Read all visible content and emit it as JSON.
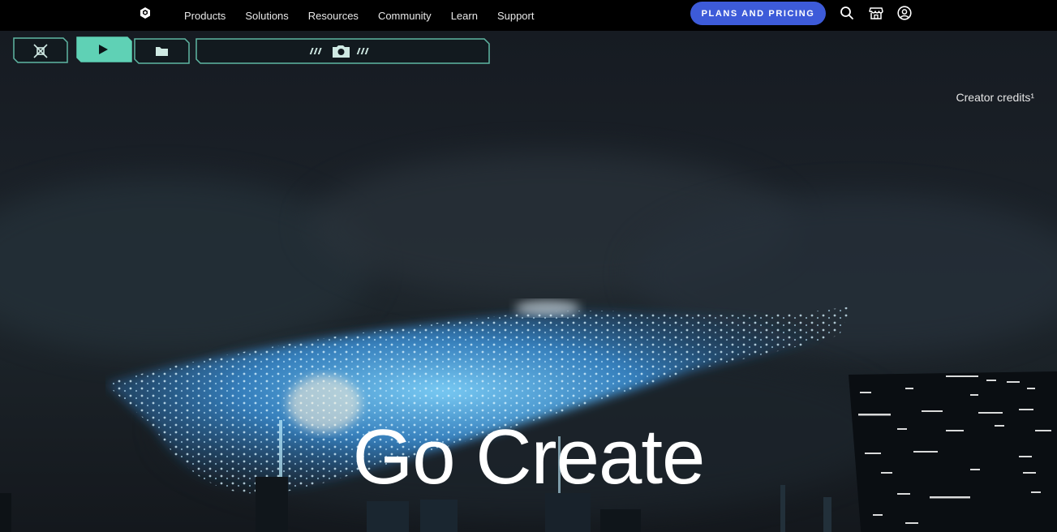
{
  "header": {
    "nav": [
      "Products",
      "Solutions",
      "Resources",
      "Community",
      "Learn",
      "Support"
    ],
    "plans_label": "PLANS AND PRICING",
    "icons": [
      "unity-logo-icon",
      "search-icon",
      "store-icon",
      "account-icon"
    ]
  },
  "hero": {
    "credits": "Creator credits¹",
    "headline": "Go Create"
  },
  "hud": {
    "buttons": [
      "crosshair-icon",
      "play-icon",
      "folder-icon",
      "camera-icon"
    ]
  },
  "colors": {
    "accent": "#3d5bd9",
    "hud_teal": "#5fd1b5"
  }
}
